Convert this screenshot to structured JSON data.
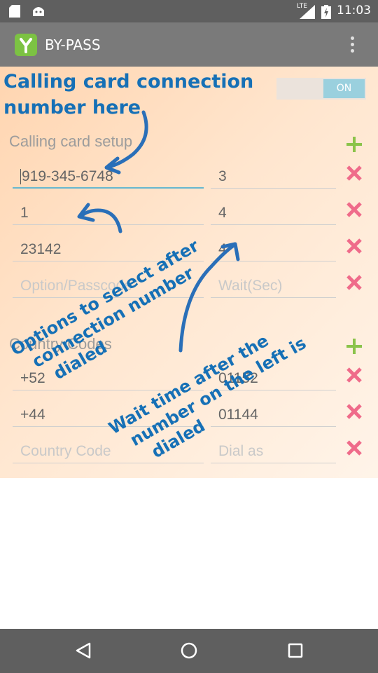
{
  "status_bar": {
    "time": "11:03",
    "network": "LTE",
    "left_icons": [
      "sd-card-icon",
      "android-icon"
    ],
    "right_icons": [
      "signal-icon",
      "battery-charging-icon"
    ]
  },
  "app_bar": {
    "title": "BY-PASS",
    "logo_icon": "bypass-logo-icon",
    "menu_icon": "overflow-menu-icon"
  },
  "toggle": {
    "label": "ON",
    "state": "on"
  },
  "calling_card": {
    "section_label": "Calling card setup",
    "rows": [
      {
        "option": "919-345-6748",
        "wait": "3"
      },
      {
        "option": "1",
        "wait": "4"
      },
      {
        "option": "23142",
        "wait": "4"
      }
    ],
    "placeholders": {
      "option": "Option/Passcode",
      "wait": "Wait(Sec)"
    }
  },
  "country_codes": {
    "section_label": "Country Codes",
    "rows": [
      {
        "code": "+52",
        "dial_as": "01152"
      },
      {
        "code": "+44",
        "dial_as": "01144"
      }
    ],
    "placeholders": {
      "code": "Country Code",
      "dial_as": "Dial as"
    }
  },
  "annotations": {
    "connection": [
      "Calling card connection",
      "number here"
    ],
    "options": [
      "Options to select after",
      "connection number",
      "dialed"
    ],
    "wait": [
      "Wait time after the",
      "number on the left is",
      "dialed"
    ]
  },
  "nav_bar": {
    "icons": [
      "back-icon",
      "home-icon",
      "recents-icon"
    ]
  },
  "colors": {
    "accent": "#67b7cf",
    "add": "#8bc34a",
    "remove": "#ef6b8a",
    "annotation": "#1670b6"
  }
}
